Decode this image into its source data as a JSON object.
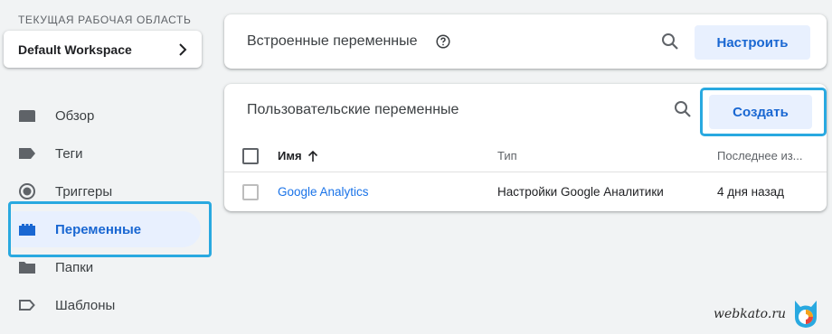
{
  "workspace": {
    "section_label": "ТЕКУЩАЯ РАБОЧАЯ ОБЛАСТЬ",
    "name": "Default Workspace",
    "chevron_icon": "chevron-right-icon"
  },
  "nav": {
    "items": [
      {
        "label": "Обзор",
        "icon": "overview-folder-icon"
      },
      {
        "label": "Теги",
        "icon": "tag-icon"
      },
      {
        "label": "Триггеры",
        "icon": "trigger-icon"
      },
      {
        "label": "Переменные",
        "icon": "variables-icon",
        "active": true
      },
      {
        "label": "Папки",
        "icon": "folder-icon"
      },
      {
        "label": "Шаблоны",
        "icon": "template-icon"
      }
    ]
  },
  "builtin": {
    "title": "Встроенные переменные",
    "configure_label": "Настроить"
  },
  "user_vars": {
    "title": "Пользовательские переменные",
    "create_label": "Создать",
    "columns": [
      "Имя",
      "Тип",
      "Последнее из..."
    ],
    "rows": [
      {
        "name": "Google Analytics",
        "type": "Настройки Google Аналитики",
        "last_edited": "4 дня назад"
      }
    ]
  },
  "watermark": {
    "text": "webkato.ru"
  },
  "colors": {
    "accent": "#1967d2",
    "button_bg": "#e8f0fe",
    "highlight": "#29a9e0"
  }
}
